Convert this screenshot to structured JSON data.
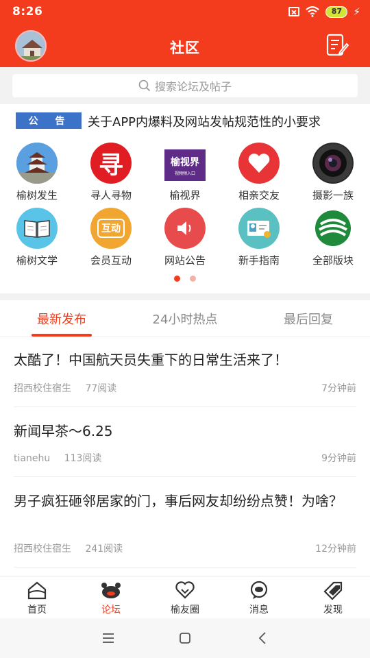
{
  "status": {
    "time": "8:26",
    "battery": "87"
  },
  "header": {
    "title": "社区"
  },
  "search": {
    "placeholder": "搜索论坛及帖子"
  },
  "notice": {
    "tag": [
      "公",
      "告"
    ],
    "text": "关于APP内爆料及网站发帖规范性的小要求"
  },
  "grid": [
    {
      "label": "榆树发生",
      "icon": "pagoda-icon"
    },
    {
      "label": "寻人寻物",
      "icon": "search-person-icon",
      "glyph": "寻",
      "color": "#e11d24"
    },
    {
      "label": "榆视界",
      "icon": "yushijie-logo",
      "glyph": "榆视界",
      "sub": "视频频入口"
    },
    {
      "label": "相亲交友",
      "icon": "heart-icon",
      "color": "#e83437"
    },
    {
      "label": "摄影一族",
      "icon": "camera-lens-icon",
      "color": "#333333"
    },
    {
      "label": "榆树文学",
      "icon": "book-icon",
      "color": "#59c4e8"
    },
    {
      "label": "会员互动",
      "icon": "interact-icon",
      "glyph": "互动",
      "color": "#f1a631"
    },
    {
      "label": "网站公告",
      "icon": "speaker-icon",
      "color": "#e84b4b"
    },
    {
      "label": "新手指南",
      "icon": "id-card-icon",
      "color": "#5ac0c2"
    },
    {
      "label": "全部版块",
      "icon": "all-boards-icon",
      "color": "#1f8a3b"
    }
  ],
  "tabs": [
    {
      "label": "最新发布",
      "active": true
    },
    {
      "label": "24小时热点",
      "active": false
    },
    {
      "label": "最后回复",
      "active": false
    }
  ],
  "posts": [
    {
      "title": "太酷了！中国航天员失重下的日常生活来了！",
      "author": "招西校住宿生",
      "reads": "77阅读",
      "time": "7分钟前"
    },
    {
      "title": "新闻早茶～6.25",
      "author": "tianehu",
      "reads": "113阅读",
      "time": "9分钟前"
    },
    {
      "title": "男子疯狂砸邻居家的门，事后网友却纷纷点赞！为啥？",
      "author": "招西校住宿生",
      "reads": "241阅读",
      "time": "12分钟前"
    }
  ],
  "nav": [
    {
      "label": "首页",
      "icon": "home-icon",
      "active": false
    },
    {
      "label": "论坛",
      "icon": "forum-icon",
      "active": true
    },
    {
      "label": "榆友圈",
      "icon": "friends-heart-icon",
      "active": false
    },
    {
      "label": "消息",
      "icon": "message-icon",
      "active": false
    },
    {
      "label": "发现",
      "icon": "discover-tag-icon",
      "active": false
    }
  ],
  "colors": {
    "brand": "#f23c1d",
    "notice_tag": "#3d72c9"
  }
}
